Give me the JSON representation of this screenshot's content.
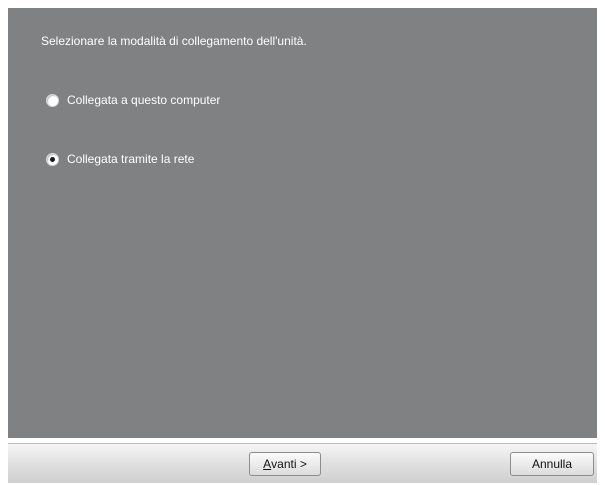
{
  "dialog": {
    "instruction": "Selezionare la modalità di collegamento dell'unità.",
    "options": [
      {
        "label": "Collegata a questo computer",
        "selected": false
      },
      {
        "label": "Collegata tramite la rete",
        "selected": true
      }
    ],
    "buttons": {
      "next_accel": "A",
      "next_rest": "vanti >",
      "cancel": "Annulla"
    }
  },
  "colors": {
    "panel_background": "#808183",
    "text": "#ffffff"
  }
}
